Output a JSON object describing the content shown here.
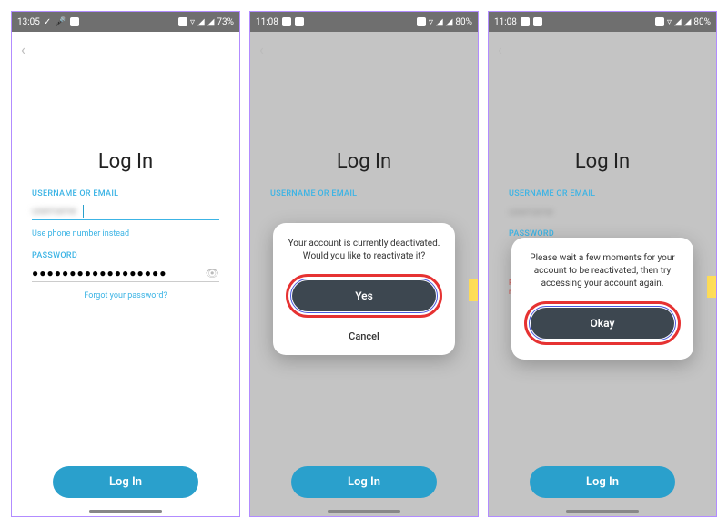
{
  "screens": [
    {
      "statusbar": {
        "time": "13:05",
        "battery": "73%"
      },
      "title": "Log In",
      "labels": {
        "username": "USERNAME OR EMAIL",
        "password": "PASSWORD"
      },
      "links": {
        "phone": "Use phone number instead",
        "forgot": "Forgot your password?"
      },
      "password_mask": "●●●●●●●●●●●●●●●●●●",
      "login_button": "Log In"
    },
    {
      "statusbar": {
        "time": "11:08",
        "battery": "80%"
      },
      "title": "Log In",
      "labels": {
        "username": "USERNAME OR EMAIL"
      },
      "login_button": "Log In",
      "dialog": {
        "message": "Your account is currently deactivated. Would you like to reactivate it?",
        "primary": "Yes",
        "secondary": "Cancel"
      }
    },
    {
      "statusbar": {
        "time": "11:08",
        "battery": "80%"
      },
      "title": "Log In",
      "labels": {
        "username": "USERNAME OR EMAIL",
        "password": "PASSWORD"
      },
      "login_button": "Log In",
      "dialog": {
        "message": "Please wait a few moments for your account to be reactivated, then try accessing your account again.",
        "primary": "Okay"
      }
    }
  ]
}
